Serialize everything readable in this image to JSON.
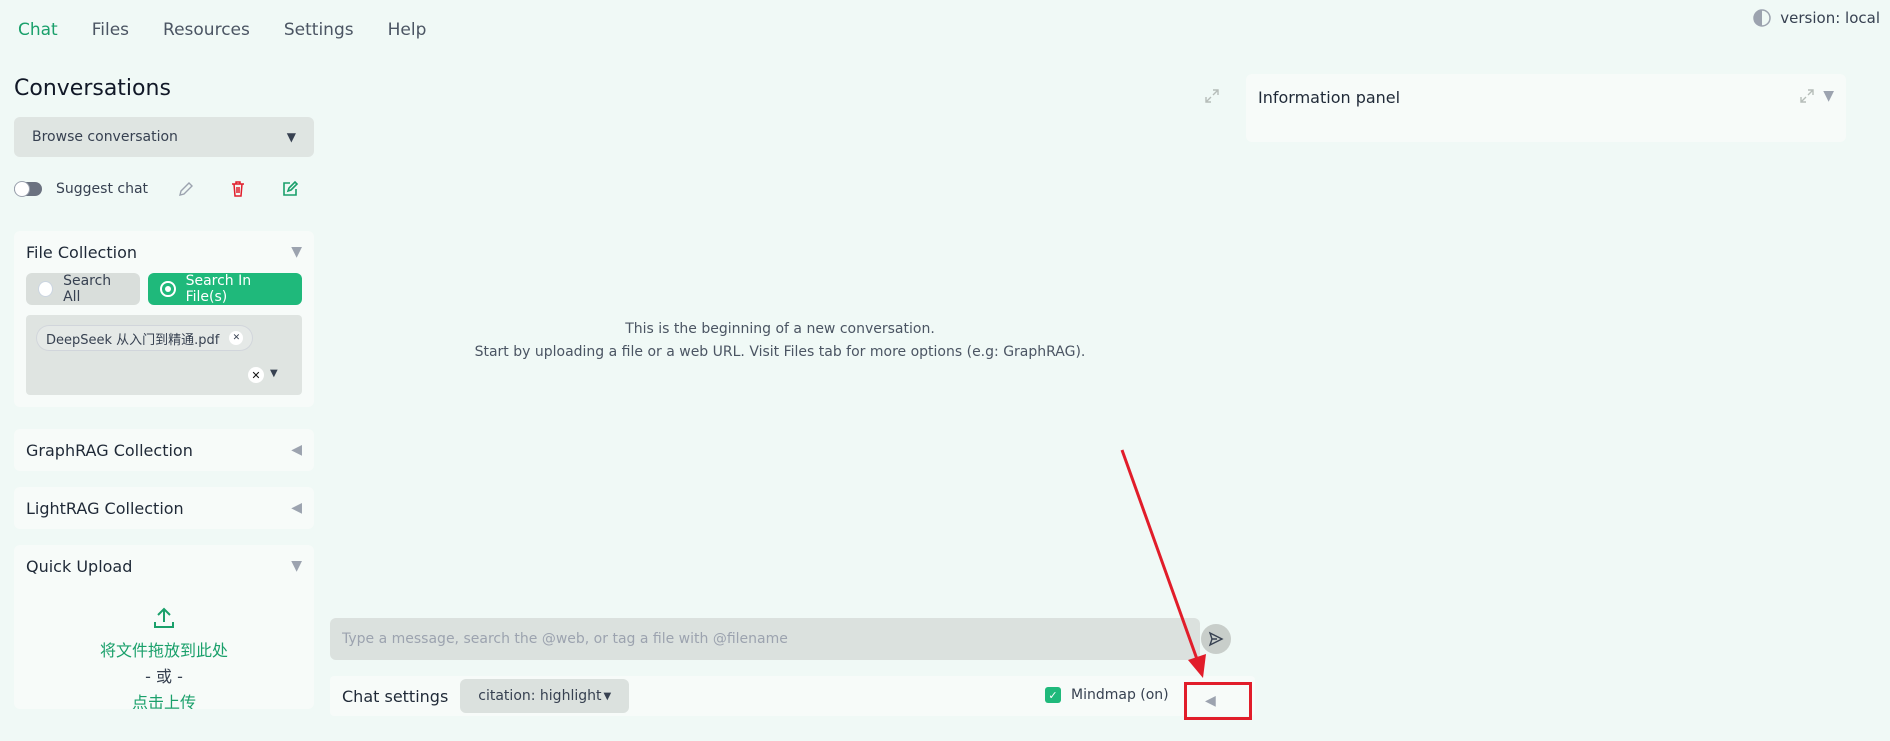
{
  "nav": {
    "tabs": [
      "Chat",
      "Files",
      "Resources",
      "Settings",
      "Help"
    ],
    "active": "Chat",
    "version": "version: local"
  },
  "sidebar": {
    "title": "Conversations",
    "browse_placeholder": "Browse conversation",
    "suggest_label": "Suggest chat",
    "file_collection": {
      "title": "File Collection",
      "search_all": "Search All",
      "search_in_files": "Search In File(s)",
      "selected_files": [
        "DeepSeek 从入门到精通.pdf"
      ]
    },
    "graphrag_title": "GraphRAG Collection",
    "lightrag_title": "LightRAG Collection",
    "quick_upload": {
      "title": "Quick Upload",
      "drop_text": "将文件拖放到此处",
      "or_text": "- 或 -",
      "click_text": "点击上传"
    }
  },
  "chat": {
    "empty_line1": "This is the beginning of a new conversation.",
    "empty_line2": "Start by uploading a file or a web URL. Visit Files tab for more options (e.g: GraphRAG).",
    "input_placeholder": "Type a message, search the @web, or tag a file with @filename",
    "settings_label": "Chat settings",
    "citation_value": "citation: highlight",
    "mindmap_label": "Mindmap (on)"
  },
  "info_panel": {
    "title": "Information panel"
  },
  "colors": {
    "accent": "#1aa06b",
    "annotation": "#e11d2a"
  }
}
